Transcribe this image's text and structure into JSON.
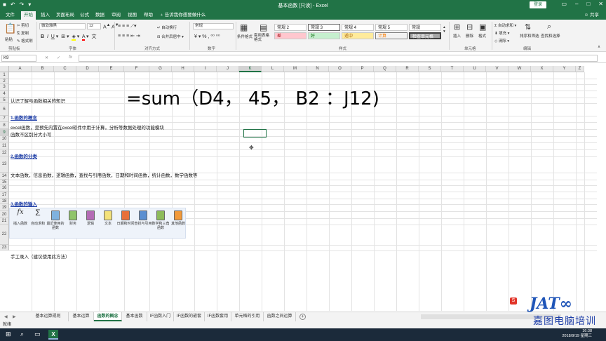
{
  "titlebar": {
    "title": "基本函数 [只读] - Excel",
    "login": "登录"
  },
  "ribbon_tabs": {
    "file": "文件",
    "home": "开始",
    "insert": "插入",
    "page_layout": "页面布局",
    "formulas": "公式",
    "data": "数据",
    "review": "审阅",
    "view": "视图",
    "help": "帮助",
    "tell_me": "告诉我你想要做什么",
    "share": "共享"
  },
  "ribbon": {
    "paste": "粘贴",
    "cut": "剪切",
    "copy": "复制",
    "format_painter": "格式刷",
    "clipboard": "剪贴板",
    "font_name": "微软雅黑",
    "font_size": "12",
    "font_group": "字体",
    "wrap_text": "自动换行",
    "merge_center": "合并后居中",
    "alignment_group": "对齐方式",
    "number_format": "常规",
    "number_group": "数字",
    "conditional_format": "条件格式",
    "format_as_table": "套用表格格式",
    "styles": [
      "常规 2",
      "常规 3",
      "常规 4",
      "常规 5",
      "常规",
      "差",
      "好",
      "适中",
      "计算",
      "检查单元格"
    ],
    "styles_group": "样式",
    "insert": "插入",
    "delete": "删除",
    "format": "格式",
    "cells_group": "单元格",
    "autosum": "自动求和",
    "fill": "填充",
    "clear": "清除",
    "sort_filter": "排序和筛选",
    "find_select": "查找和选择",
    "editing_group": "编辑"
  },
  "formula_bar": {
    "name_box": "K9",
    "value": ""
  },
  "columns": [
    "A",
    "B",
    "C",
    "D",
    "E",
    "F",
    "G",
    "H",
    "I",
    "J",
    "K",
    "L",
    "M",
    "N",
    "O",
    "P",
    "Q",
    "R",
    "S",
    "T",
    "U",
    "V",
    "W",
    "X",
    "Y",
    "Z"
  ],
  "selected_column": "K",
  "rows": [
    "1",
    "2",
    "3",
    "4",
    "5",
    "6",
    "7",
    "8",
    "9",
    "10",
    "11",
    "12",
    "13",
    "14",
    "15",
    "16",
    "17",
    "18",
    "19",
    "20",
    "21",
    "22",
    "23"
  ],
  "selected_row": "9",
  "cells": {
    "r4": "认识了解与函数相关的知识",
    "r6": "1.函数的概念",
    "r8": "excel函数，是预先内置在excel软件中用于计算，分析等数据处理的功能模块",
    "r9": "函数不区别分大小写",
    "r12": "2.函数的分类",
    "r13": "文本函数，信息函数，逻辑函数，查找与引用函数，日期和时间函数，统计函数，数学函数等",
    "r17": "3.函数的输入",
    "r22": "手工录入（建议使用此方法）"
  },
  "big_formula": "=sum（D4，  45，  B2 ：J12)",
  "function_library": [
    {
      "label": "插入函数",
      "icon": "fx-icon"
    },
    {
      "label": "自动求和",
      "icon": "sigma-icon"
    },
    {
      "label": "最近使用的函数",
      "icon": "book-icon"
    },
    {
      "label": "财务",
      "icon": "book-icon"
    },
    {
      "label": "逻辑",
      "icon": "book-icon"
    },
    {
      "label": "文本",
      "icon": "book-icon"
    },
    {
      "label": "日期和时间",
      "icon": "book-icon"
    },
    {
      "label": "查找与引用",
      "icon": "book-icon"
    },
    {
      "label": "数学和三角函数",
      "icon": "book-icon"
    },
    {
      "label": "其他函数",
      "icon": "book-icon"
    }
  ],
  "sheet_tabs": [
    "基本运算规则",
    "基本运算",
    "函数的概念",
    "基本函数",
    "IF函数入门",
    "IF函数的嵌套",
    "IF函数套用",
    "单元格的引用",
    "函数之间运算"
  ],
  "active_sheet": "函数的概念",
  "status": {
    "ready": "就绪"
  },
  "taskbar": {
    "time": "16:38",
    "date": "2018/9/19 星期三"
  },
  "watermark": {
    "text": "嘉图电脑培训"
  }
}
